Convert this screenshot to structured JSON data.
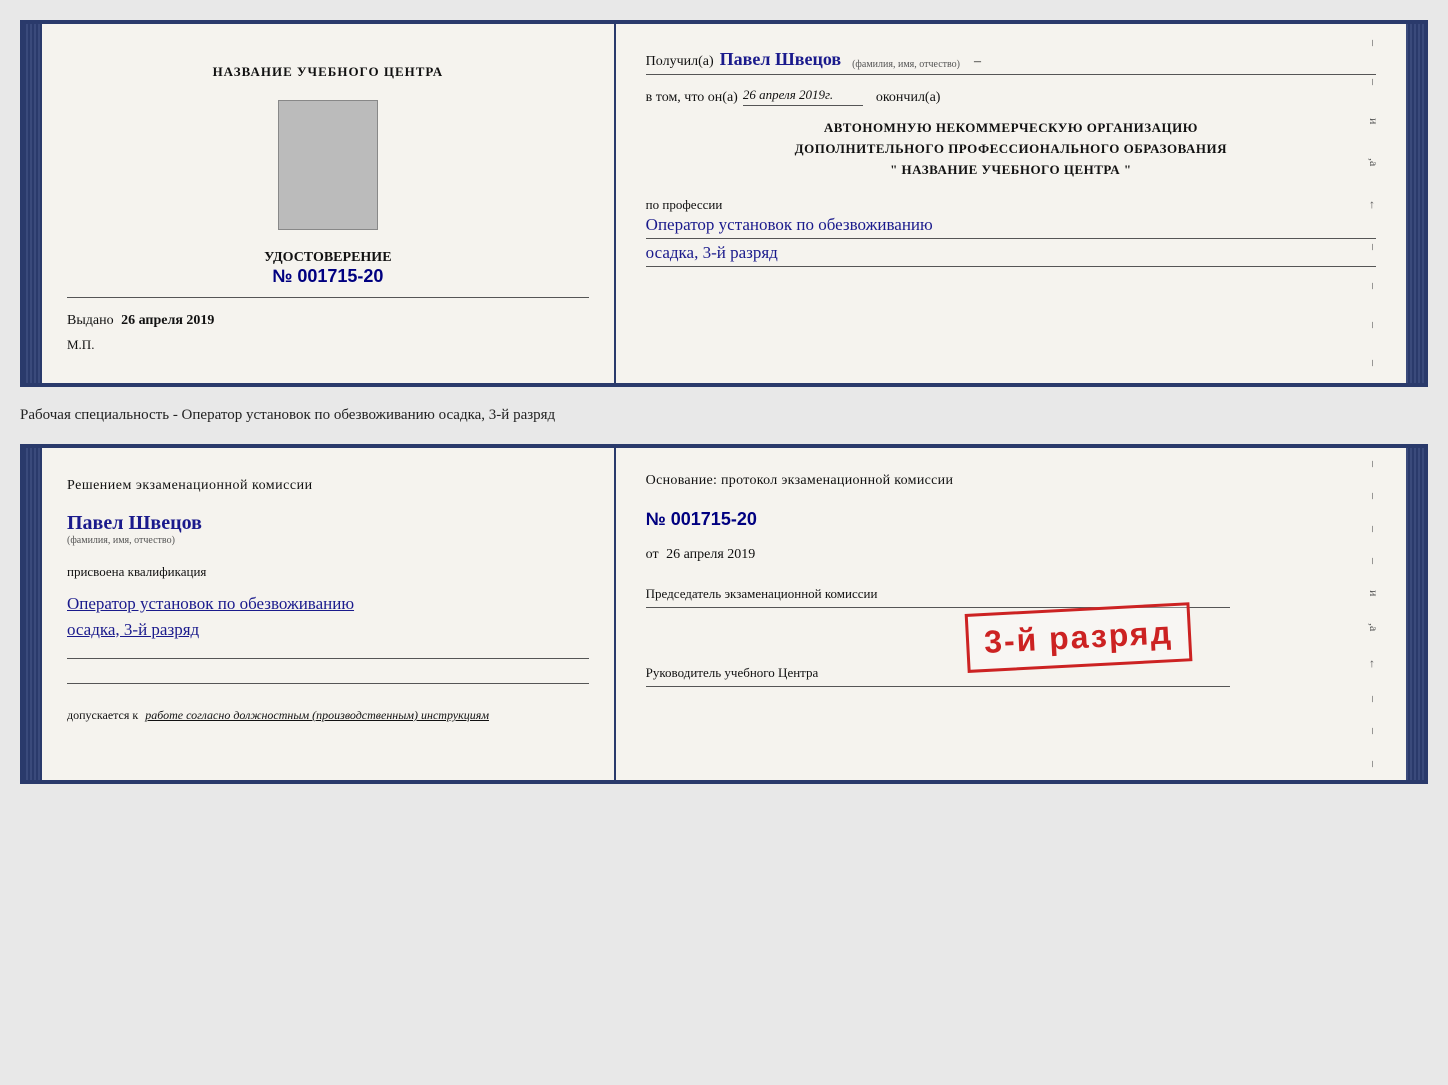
{
  "top_doc": {
    "left": {
      "title": "НАЗВАНИЕ УЧЕБНОГО ЦЕНТРА",
      "cert_label": "УДОСТОВЕРЕНИЕ",
      "cert_number_prefix": "№",
      "cert_number": "001715-20",
      "issued_prefix": "Выдано",
      "issued_date": "26 апреля 2019",
      "mp_label": "М.П."
    },
    "right": {
      "received_prefix": "Получил(а)",
      "recipient_name": "Павел Швецов",
      "recipient_sub": "(фамилия, имя, отчество)",
      "dash": "–",
      "confirm_prefix": "в том, что он(а)",
      "confirm_date": "26 апреля 2019г.",
      "confirm_suffix": "окончил(а)",
      "org_line1": "АВТОНОМНУЮ НЕКОММЕРЧЕСКУЮ ОРГАНИЗАЦИЮ",
      "org_line2": "ДОПОЛНИТЕЛЬНОГО ПРОФЕССИОНАЛЬНОГО ОБРАЗОВАНИЯ",
      "org_line3": "\"   НАЗВАНИЕ УЧЕБНОГО ЦЕНТРА   \"",
      "profession_prefix": "по профессии",
      "profession_name": "Оператор установок по обезвоживанию",
      "specialty": "осадка, 3-й разряд"
    }
  },
  "between_label": "Рабочая специальность - Оператор установок по обезвоживанию осадка, 3-й разряд",
  "bottom_doc": {
    "left": {
      "decision_title": "Решением экзаменационной комиссии",
      "name": "Павел Швецов",
      "name_sub": "(фамилия, имя, отчество)",
      "qualification_text": "присвоена квалификация",
      "profession_line1": "Оператор установок по обезвоживанию",
      "profession_line2": "осадка, 3-й разряд",
      "допуск_prefix": "допускается к",
      "допуск_text": "работе согласно должностным (производственным) инструкциям"
    },
    "right": {
      "basis_title": "Основание: протокол экзаменационной комиссии",
      "number_prefix": "№",
      "number": "001715-20",
      "date_prefix": "от",
      "date": "26 апреля 2019",
      "chairman_label": "Председатель экзаменационной комиссии",
      "head_label": "Руководитель учебного Центра"
    },
    "stamp_text": "3-й разряд"
  }
}
